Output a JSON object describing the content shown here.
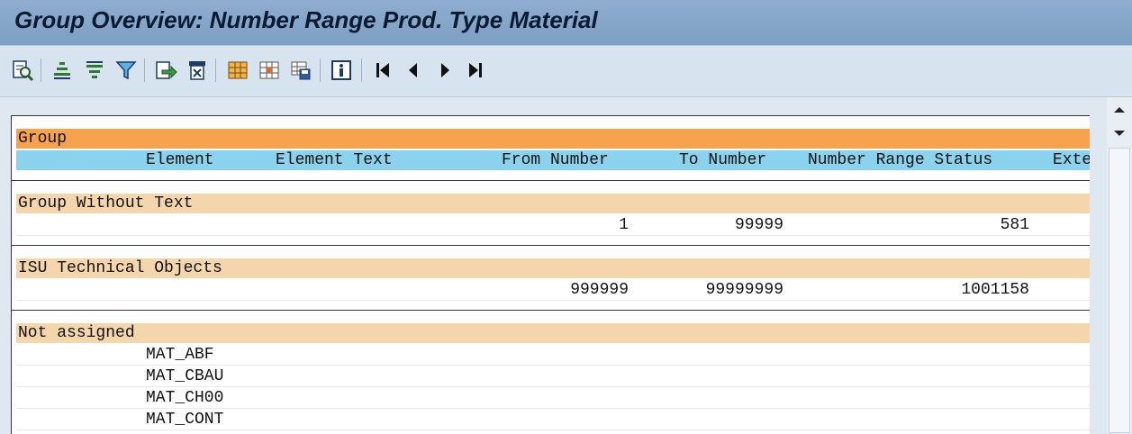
{
  "window": {
    "title": "Group Overview: Number Range Prod. Type Material"
  },
  "toolbar": {
    "icons": [
      "details-icon",
      "sort-ascending-icon",
      "sort-descending-icon",
      "filter-icon",
      "export-icon",
      "print-icon",
      "layout-icon",
      "change-layout-icon",
      "save-layout-icon",
      "info-icon",
      "first-page-icon",
      "previous-page-icon",
      "next-page-icon",
      "last-page-icon"
    ]
  },
  "table": {
    "group_label": "Group",
    "columns": {
      "element": "Element",
      "element_text": "Element Text",
      "from_number": "From Number",
      "to_number": "To Number",
      "number_range_status": "Number Range Status",
      "external": "Exte"
    },
    "groups": [
      {
        "name": "Group Without Text",
        "from": "1",
        "to": "99999",
        "status": "581"
      },
      {
        "name": "ISU Technical Objects",
        "from": "999999",
        "to": "99999999",
        "status": "1001158"
      },
      {
        "name": "Not assigned",
        "elements": [
          "MAT_ABF",
          "MAT_CBAU",
          "MAT_CH00",
          "MAT_CONT"
        ]
      }
    ]
  },
  "colors": {
    "group_header": "#f6a24f",
    "column_header": "#8ad2ee",
    "group_row": "#f5d6ac",
    "title_bar": "#8eadcf"
  }
}
